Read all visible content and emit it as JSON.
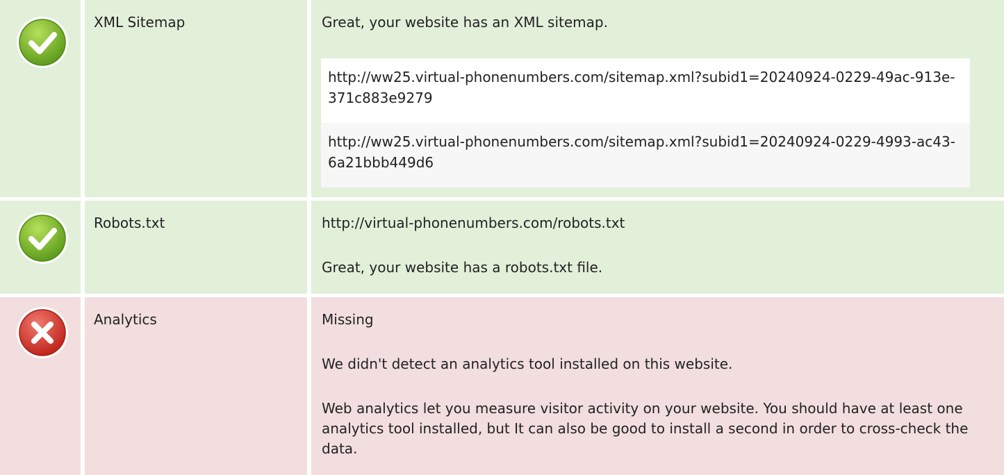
{
  "rows": [
    {
      "status": "pass",
      "name": "XML Sitemap",
      "message": "Great, your website has an XML sitemap.",
      "urls": [
        "http://ww25.virtual-phonenumbers.com/sitemap.xml?subid1=20240924-0229-49ac-913e-371c883e9279",
        "http://ww25.virtual-phonenumbers.com/sitemap.xml?subid1=20240924-0229-4993-ac43-6a21bbb449d6"
      ]
    },
    {
      "status": "pass",
      "name": "Robots.txt",
      "url": "http://virtual-phonenumbers.com/robots.txt",
      "message": "Great, your website has a robots.txt file."
    },
    {
      "status": "fail",
      "name": "Analytics",
      "value": "Missing",
      "message": "We didn't detect an analytics tool installed on this website.",
      "advice": "Web analytics let you measure visitor activity on your website. You should have at least one analytics tool installed, but It can also be good to install a second in order to cross-check the data."
    }
  ],
  "colors": {
    "pass_bg": "#e2f0da",
    "fail_bg": "#f2dede",
    "pass_icon": "#7cb82f",
    "fail_icon": "#d9352b"
  },
  "icons": {
    "pass": "check-circle-icon",
    "fail": "cross-circle-icon"
  }
}
